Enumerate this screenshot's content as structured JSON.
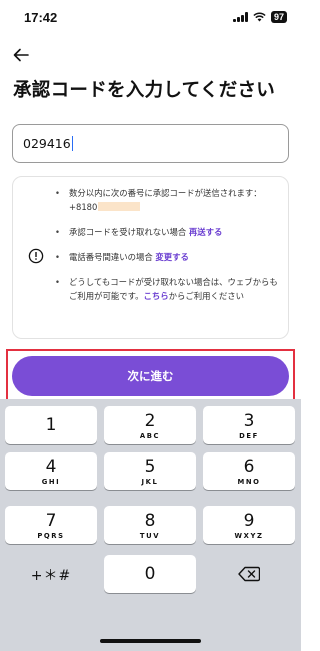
{
  "status_bar": {
    "time": "17:42",
    "battery": "97",
    "icons": [
      "signal-icon",
      "wifi-icon",
      "battery-icon"
    ]
  },
  "header": {
    "back_icon": "arrow-left-icon",
    "title": "承認コードを入力してください"
  },
  "code_input": {
    "value": "029416"
  },
  "info_card": {
    "icon": "info-circle-icon",
    "items": [
      {
        "text": "数分以内に次の番号に承認コードが送信されます：+8180",
        "masked_icon": "redacted-number"
      },
      {
        "text": "承認コードを受け取れない場合 ",
        "link": "再送する"
      },
      {
        "text": "電話番号間違いの場合 ",
        "link": "変更する"
      },
      {
        "text": "どうしてもコードが受け取れない場合は、ウェブからもご利用が可能です。",
        "link": "こちら",
        "text_after": "からご利用ください"
      }
    ]
  },
  "next_button": {
    "label": "次に進む",
    "highlight_color": "#e33040",
    "color": "#7a4dd6"
  },
  "keyboard": {
    "keys": [
      {
        "num": "1",
        "letters": ""
      },
      {
        "num": "2",
        "letters": "ABC"
      },
      {
        "num": "3",
        "letters": "DEF"
      },
      {
        "num": "4",
        "letters": "GHI"
      },
      {
        "num": "5",
        "letters": "JKL"
      },
      {
        "num": "6",
        "letters": "MNO"
      },
      {
        "num": "7",
        "letters": "PQRS"
      },
      {
        "num": "8",
        "letters": "TUV"
      },
      {
        "num": "9",
        "letters": "WXYZ"
      }
    ],
    "symbols_key": "+＊#",
    "zero_key": "0",
    "delete_icon": "backspace-icon"
  }
}
